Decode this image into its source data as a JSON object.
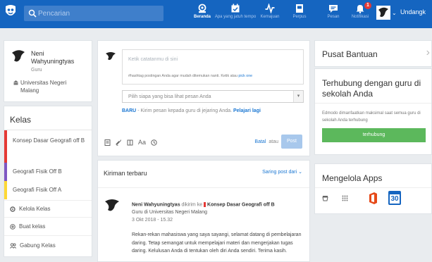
{
  "header": {
    "search_placeholder": "Pencarian",
    "nav": [
      {
        "label": "Beranda",
        "icon": "home-icon",
        "active": true
      },
      {
        "label": "Apa yang jatuh tempo",
        "icon": "calendar-check-icon",
        "active": false
      },
      {
        "label": "Kemajuan",
        "icon": "progress-pulse-icon",
        "active": false
      },
      {
        "label": "Perpus",
        "icon": "library-icon",
        "active": false
      },
      {
        "label": "Pesan",
        "icon": "message-icon",
        "active": false
      },
      {
        "label": "Notifikasi",
        "icon": "bell-icon",
        "active": false,
        "badge": "1"
      }
    ],
    "invite_label": "Undangk"
  },
  "profile": {
    "name": "Neni Wahyuningtyas",
    "role": "Guru",
    "institution": "Universitas Negeri Malang"
  },
  "kelas": {
    "title": "Kelas",
    "classes": [
      {
        "name": "Konsep Dasar Geografi off B",
        "color": "#e53935"
      },
      {
        "name": "Geografi Fisik Off B",
        "color": "#7e57c2"
      },
      {
        "name": "Geografi Fisik Off A",
        "color": "#fdd835"
      }
    ],
    "links": [
      {
        "label": "Kelola Kelas",
        "icon": "gear-icon"
      },
      {
        "label": "Buat kelas",
        "icon": "plus-circle-icon"
      },
      {
        "label": "Gabung Kelas",
        "icon": "users-icon"
      }
    ]
  },
  "compose": {
    "note_placeholder": "Ketik catatanmu di sini",
    "hashtag_hint": "#hashtag postingan Anda agar mudah ditemukan nanti. Ketik atau",
    "hashtag_link": "pick one",
    "audience_placeholder": "Pilih siapa yang bisa lihat pesan Anda",
    "new_label": "BARU",
    "new_text": "- Kirim pesan kepada guru di jejaring Anda.",
    "learn_more": "Pelajari lagi",
    "cancel": "Batal",
    "or": "atau",
    "post": "Post"
  },
  "feed": {
    "title": "Kiriman terbaru",
    "filter": "Saring post dari",
    "post": {
      "author": "Neni Wahyuningtyas",
      "sent_to": "dikirim ke",
      "group": "Konsep Dasar Geografi off B",
      "group_color": "#e53935",
      "role_line": "Guru di Universitas Negeri Malang",
      "timestamp": "3 Okt 2018 - 15.32",
      "body": "Rekan-rekan mahasiswa yang saya sayangi, selamat datang di pembelajaran daring. Tetap semangat untuk mempelajari materi dan mengerjakan tugas daring. Kelulusan Anda di tentukan oleh diri Anda sendiri. Terima kasih."
    }
  },
  "right": {
    "help_title": "Pusat Bantuan",
    "connect_title": "Terhubung dengan guru di sekolah Anda",
    "connect_text": "Edmodo dimanfaatkan maksimal saat semua guru di sekolah Anda terhubung",
    "connect_button": "terhubung",
    "apps_title": "Mengelola Apps",
    "apps_badge": "30"
  },
  "colors": {
    "topbar": "#1565c0",
    "accent": "#1976d2",
    "green": "#5cb85c",
    "office": "#e64a19"
  }
}
